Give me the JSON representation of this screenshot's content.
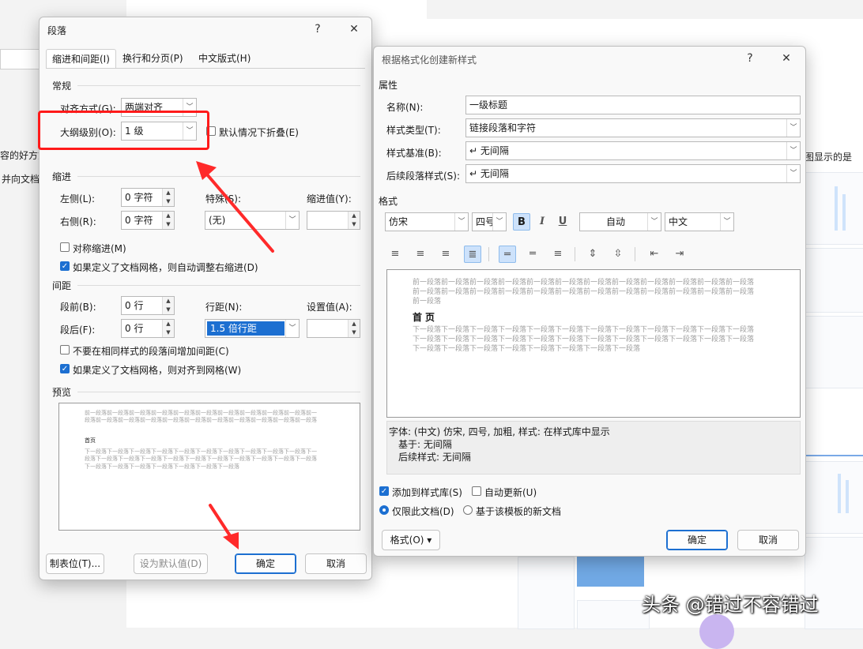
{
  "background": {
    "fragment_left_1": "容的好方式",
    "fragment_left_2": "并向文档",
    "fragment_right": "图显示的是"
  },
  "paragraph_dialog": {
    "title": "段落",
    "help_label": "?",
    "close_label": "✕",
    "tabs": [
      "缩进和间距(I)",
      "换行和分页(P)",
      "中文版式(H)"
    ],
    "general_section": "常规",
    "alignment_label": "对齐方式(G):",
    "alignment_value": "两端对齐",
    "outline_label": "大纲级别(O):",
    "outline_value": "1 级",
    "collapse_label": "默认情况下折叠(E)",
    "indent_section": "缩进",
    "left_label": "左侧(L):",
    "left_value": "0 字符",
    "right_label": "右侧(R):",
    "right_value": "0 字符",
    "special_label": "特殊(S):",
    "special_value": "(无)",
    "indent_value_label": "缩进值(Y):",
    "mirror_label": "对称缩进(M)",
    "auto_indent_label": "如果定义了文档网格，则自动调整右缩进(D)",
    "spacing_section": "间距",
    "before_label": "段前(B):",
    "before_value": "0 行",
    "after_label": "段后(F):",
    "after_value": "0 行",
    "line_spacing_label": "行距(N):",
    "line_spacing_value": "1.5 倍行距",
    "set_value_label": "设置值(A):",
    "no_space_label": "不要在相同样式的段落间增加间距(C)",
    "snap_grid_label": "如果定义了文档网格，则对齐到网格(W)",
    "preview_section": "预览",
    "preview_before": "前一段落前一段落前一段落前一段落前一段落前一段落前一段落前一段落前一段落前一段落前一段落前一段落前一段落前一段落前一段落前一段落前一段落前一段落前一段落前一段落前一段落",
    "preview_sample": "首页",
    "preview_after": "下一段落下一段落下一段落下一段落下一段落下一段落下一段落下一段落下一段落下一段落下一段落下一段落下一段落下一段落下一段落下一段落下一段落下一段落下一段落下一段落下一段落下一段落下一段落下一段落下一段落下一段落下一段落下一段落",
    "tabs_button": "制表位(T)...",
    "default_button": "设为默认值(D)",
    "ok_button": "确定",
    "cancel_button": "取消"
  },
  "style_dialog": {
    "title": "根据格式化创建新样式",
    "help_label": "?",
    "close_label": "✕",
    "properties_section": "属性",
    "name_label": "名称(N):",
    "name_value": "一级标题",
    "type_label": "样式类型(T):",
    "type_value": "链接段落和字符",
    "based_on_label": "样式基准(B):",
    "based_on_value": "↵ 无间隔",
    "following_label": "后续段落样式(S):",
    "following_value": "↵ 无间隔",
    "format_section": "格式",
    "font_value": "仿宋",
    "size_value": "四号",
    "bold_label": "B",
    "italic_label": "I",
    "underline_label": "U",
    "color_value": "自动",
    "lang_value": "中文",
    "preview_before": "前一段落前一段落前一段落前一段落前一段落前一段落前一段落前一段落前一段落前一段落前一段落前一段落前一段落前一段落前一段落前一段落前一段落前一段落前一段落前一段落前一段落前一段落前一段落前一段落前一段落",
    "preview_sample": "首页",
    "preview_after": "下一段落下一段落下一段落下一段落下一段落下一段落下一段落下一段落下一段落下一段落下一段落下一段落下一段落下一段落下一段落下一段落下一段落下一段落下一段落下一段落下一段落下一段落下一段落下一段落下一段落下一段落下一段落下一段落下一段落下一段落下一段落下一段落",
    "desc_line1": "字体: (中文) 仿宋, 四号, 加粗, 样式: 在样式库中显示",
    "desc_line2": "基于: 无间隔",
    "desc_line3": "后续样式: 无间隔",
    "add_gallery_label": "添加到样式库(S)",
    "auto_update_label": "自动更新(U)",
    "only_doc_label": "仅限此文档(D)",
    "template_label": "基于该模板的新文档",
    "format_button": "格式(O) ▾",
    "ok_button": "确定",
    "cancel_button": "取消"
  },
  "watermark": "头条 @错过不容错过",
  "colors": {
    "accent": "#1c6fd1",
    "annotation": "#ff1a1a"
  }
}
